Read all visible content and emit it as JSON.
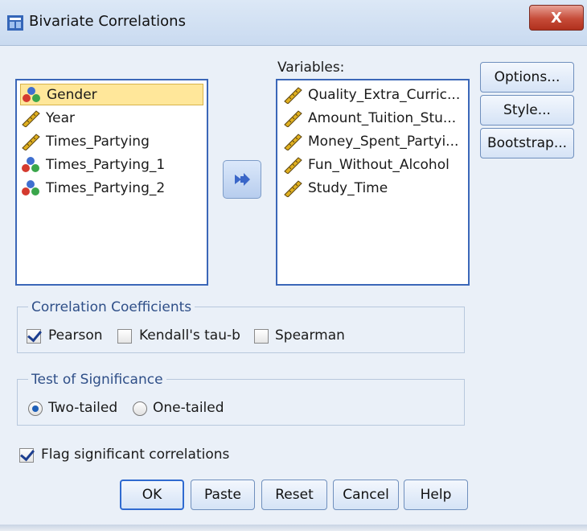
{
  "window": {
    "title": "Bivariate Correlations",
    "close_label": "X"
  },
  "source_list": {
    "items": [
      {
        "label": "Gender",
        "type": "nominal",
        "selected": true
      },
      {
        "label": "Year",
        "type": "scale",
        "selected": false
      },
      {
        "label": "Times_Partying",
        "type": "scale",
        "selected": false
      },
      {
        "label": "Times_Partying_1",
        "type": "nominal",
        "selected": false
      },
      {
        "label": "Times_Partying_2",
        "type": "nominal",
        "selected": false
      }
    ]
  },
  "variables": {
    "label": "Variables:",
    "items": [
      {
        "label": "Quality_Extra_Curric...",
        "type": "scale"
      },
      {
        "label": "Amount_Tuition_Stu...",
        "type": "scale"
      },
      {
        "label": "Money_Spent_Partyi...",
        "type": "scale"
      },
      {
        "label": "Fun_Without_Alcohol",
        "type": "scale"
      },
      {
        "label": "Study_Time",
        "type": "scale"
      }
    ]
  },
  "side_buttons": {
    "options": "Options...",
    "style": "Style...",
    "bootstrap": "Bootstrap..."
  },
  "coefficients": {
    "title": "Correlation Coefficients",
    "pearson": {
      "label": "Pearson",
      "checked": true
    },
    "kendall": {
      "label": "Kendall's tau-b",
      "checked": false
    },
    "spearman": {
      "label": "Spearman",
      "checked": false
    }
  },
  "significance": {
    "title": "Test of Significance",
    "two_tailed": {
      "label": "Two-tailed",
      "selected": true
    },
    "one_tailed": {
      "label": "One-tailed",
      "selected": false
    }
  },
  "flag": {
    "label": "Flag significant correlations",
    "checked": true
  },
  "footer_buttons": {
    "ok": "OK",
    "paste": "Paste",
    "reset": "Reset",
    "cancel": "Cancel",
    "help": "Help"
  },
  "colors": {
    "list_border": "#3b67b8",
    "selection": "#ffe79a",
    "ruler_icon": "#e0b020",
    "nominal_red": "#d43a2f",
    "nominal_blue": "#3f6fd0",
    "nominal_green": "#3aa64b"
  }
}
